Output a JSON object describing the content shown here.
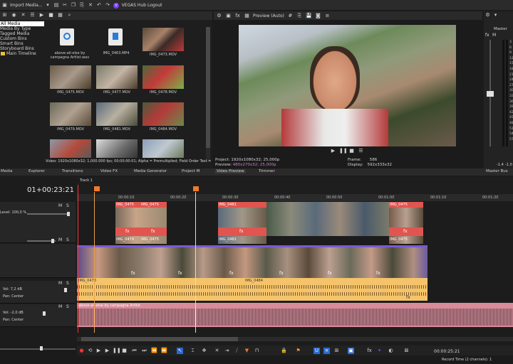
{
  "toolbar": {
    "import_label": "Import Media...",
    "hub_label": "VEGAS Hub Logout"
  },
  "explorer": {
    "tree": [
      "All Media",
      "Media By Type",
      "Tagged Media",
      "Custom Bins",
      "Smart Bins",
      "Storyboard Bins",
      "Main Timeline"
    ],
    "files": [
      {
        "name": "above-all-else by campagna Artlist.wav",
        "type": "audio"
      },
      {
        "name": "IMG_0463.MP4",
        "type": "doc"
      },
      {
        "name": "IMG_0473.MOV",
        "type": "video"
      },
      {
        "name": "IMG_0475.MOV",
        "type": "video"
      },
      {
        "name": "IMG_0477.MOV",
        "type": "video"
      },
      {
        "name": "IMG_0478.MOV",
        "type": "video"
      },
      {
        "name": "IMG_0479.MOV",
        "type": "video"
      },
      {
        "name": "IMG_0481.MOV",
        "type": "video"
      },
      {
        "name": "IMG_0484.MOV",
        "type": "video"
      }
    ],
    "status": "Video: 1920x1080x32; 1,000.000 fps; 00:00:00:01; Alpha = Premultiplied; Field Order Test ="
  },
  "preview": {
    "mode": "Preview (Auto)",
    "project_label": "Project:",
    "project_value": "1920x1080x32; 25,000p",
    "preview_label": "Preview:",
    "preview_value": "480x270x32; 25,000p",
    "frame_label": "Frame:",
    "frame_value": "586",
    "display_label": "Display:",
    "display_value": "592x333x32"
  },
  "master": {
    "title": "Master",
    "scale": [
      "3",
      "6",
      "9",
      "12",
      "15",
      "18",
      "21",
      "24",
      "27",
      "30",
      "33",
      "36",
      "39",
      "42",
      "45",
      "48",
      "51",
      "54",
      "57"
    ],
    "level_left": "-1.4",
    "level_right": "-1.0",
    "tab": "Master Bus"
  },
  "tabs": [
    {
      "label": "Media"
    },
    {
      "label": "Explorer"
    },
    {
      "label": "Transitions"
    },
    {
      "label": "Video FX"
    },
    {
      "label": "Media Generator"
    },
    {
      "label": "Project M"
    },
    {
      "label": "Video Preview"
    },
    {
      "label": "Trimmer"
    }
  ],
  "timeline": {
    "timecode": "01+00:23:21",
    "track_label": "Track 1",
    "ruler": [
      "00:00:10",
      "00:00:20",
      "00:00:30",
      "00:00:40",
      "00:00:50",
      "00:01:00",
      "00:01:10",
      "00:01:20"
    ],
    "tracks": [
      {
        "level": "Level: 100,0 %",
        "m": "M",
        "s": "S"
      },
      {
        "level": "Level: 100,0 %",
        "m": "M",
        "s": "S"
      },
      {
        "vol": "Vol: 7,2 dB",
        "pan": "Pan: Center",
        "m": "M",
        "s": "S"
      },
      {
        "vol": "Vol: -2,0 dB",
        "pan": "Pan: Center",
        "m": "M",
        "s": "S"
      }
    ],
    "clip_labels": {
      "t1": [
        "IMG_0475",
        "IMG_0475",
        "IMG_0481",
        "IMG_0475"
      ],
      "t1b": [
        "IMG_0479",
        "IMG_0475",
        "IMG_0481",
        "IMG_0475"
      ],
      "t2": "IMG_0473",
      "a1": [
        "IMG_0473",
        "IMG_0484"
      ],
      "a2": "above-all-else by campagna Artlist"
    },
    "fx": "fx"
  },
  "bottom": {
    "timecode": "00:00:25:21",
    "record": "Record Time (2 channels): 1"
  },
  "colors": {
    "accent": "#7a3df0",
    "clip_red": "#e0554f",
    "clip_orange": "#f2a33b",
    "audio_yellow": "#f4c36a",
    "audio_pink": "#d98b9a",
    "playhead": "#ff3030"
  }
}
